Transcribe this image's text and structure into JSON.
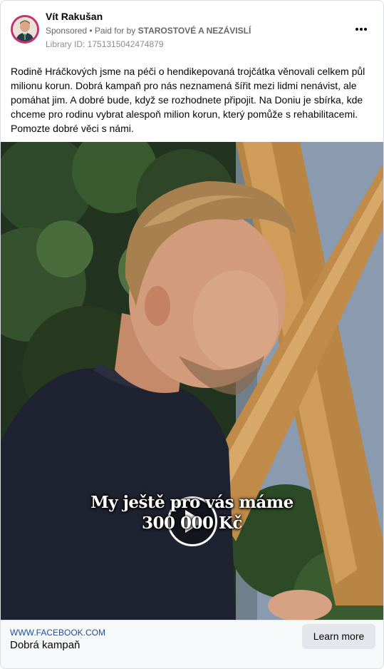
{
  "ad": {
    "page_name": "Vít Rakušan",
    "sponsored": "Sponsored",
    "paid_for_prefix": " • Paid for by ",
    "paid_for_by": "STAROSTOVÉ A NEZÁVISLÍ",
    "library_id": "Library ID: 1751315042474879",
    "more_icon": "more-horizontal-icon",
    "body": "Rodině Hráčkových jsme na péči o hendikepovaná trojčátka věnovali celkem půl milionu korun. Dobrá kampaň pro nás neznamená šířit mezi lidmi nenávist, ale pomáhat jim. A dobré bude, když se rozhodnete připojit. Na Doniu je sbírka, kde chceme pro rodinu vybrat alespoň milion korun, který pomůže s rehabilitacemi. Pomozte dobré věci s námi."
  },
  "video": {
    "caption_line1": "My ještě pro vás máme",
    "caption_line2": "300 000 Kč",
    "play_icon": "play-icon"
  },
  "footer": {
    "domain": "WWW.FACEBOOK.COM",
    "headline": "Dobrá kampaň",
    "cta_label": "Learn more"
  },
  "colors": {
    "avatar_ring": "#c8306d",
    "link_blue": "#1d4f91",
    "button_gray": "#e4e6eb"
  }
}
